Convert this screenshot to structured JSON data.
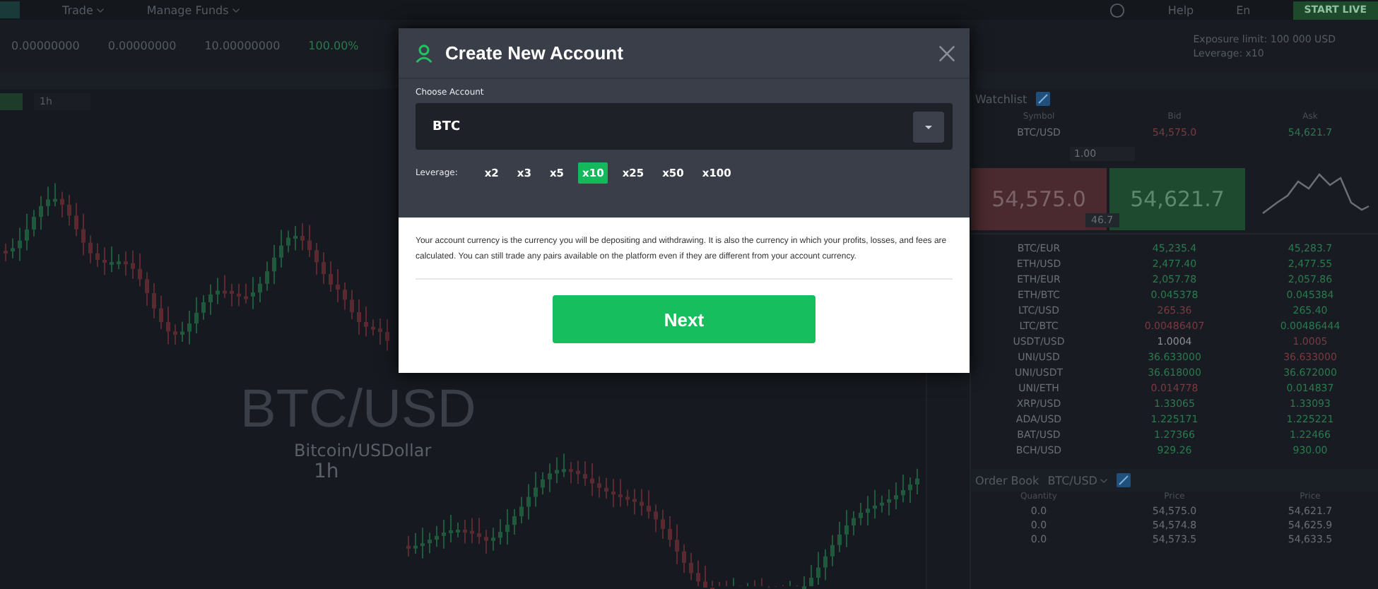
{
  "top_nav": {
    "items": [
      {
        "label": "Trade"
      },
      {
        "label": "Manage Funds"
      }
    ],
    "help": "Help",
    "language": "En",
    "start_button": "START LIVE"
  },
  "stats": {
    "values": [
      {
        "text": "0.00000000",
        "kind": "plain"
      },
      {
        "text": "0.00000000",
        "kind": "plain"
      },
      {
        "text": "10.00000000",
        "kind": "plain"
      },
      {
        "text": "100.00%",
        "kind": "positive"
      }
    ],
    "exposure": "Exposure limit: 100 000 USD",
    "leverage": "Leverage: x10"
  },
  "chart_toolbar": {
    "interval": "1h"
  },
  "chart": {
    "symbol": "BTC/USD",
    "description": "Bitcoin/USDollar",
    "interval": "1h"
  },
  "watchlist": {
    "title": "Watchlist",
    "columns": [
      "Symbol",
      "Bid",
      "Ask"
    ],
    "top_row": {
      "symbol": "BTC/USD",
      "bid": "54,575.0",
      "ask": "54,621.7"
    },
    "trade": {
      "quantity": "1.00",
      "sell_price": "54,575.0",
      "buy_price": "54,621.7",
      "spread": "46.7"
    },
    "rows": [
      {
        "symbol": "BTC/EUR",
        "bid": {
          "text": "45,235.4",
          "color": "#2a7a4e"
        },
        "ask": {
          "text": "45,283.7",
          "color": "#2a7a4e"
        }
      },
      {
        "symbol": "ETH/USD",
        "bid": {
          "text": "2,477.40",
          "color": "#2a7a4e"
        },
        "ask": {
          "text": "2,477.55",
          "color": "#2a7a4e"
        }
      },
      {
        "symbol": "ETH/EUR",
        "bid": {
          "text": "2,057.78",
          "color": "#2a7a4e"
        },
        "ask": {
          "text": "2,057.86",
          "color": "#2a7a4e"
        }
      },
      {
        "symbol": "ETH/BTC",
        "bid": {
          "text": "0.045378",
          "color": "#2a7a4e"
        },
        "ask": {
          "text": "0.045384",
          "color": "#2a7a4e"
        }
      },
      {
        "symbol": "LTC/USD",
        "bid": {
          "text": "265.36",
          "color": "#7a3a40"
        },
        "ask": {
          "text": "265.40",
          "color": "#2a7a4e"
        }
      },
      {
        "symbol": "LTC/BTC",
        "bid": {
          "text": "0.00486407",
          "color": "#7a3a40"
        },
        "ask": {
          "text": "0.00486444",
          "color": "#2a7a4e"
        }
      },
      {
        "symbol": "USDT/USD",
        "bid": {
          "text": "1.0004",
          "color": "#8a8f96"
        },
        "ask": {
          "text": "1.0005",
          "color": "#7a3a40"
        }
      },
      {
        "symbol": "UNI/USD",
        "bid": {
          "text": "36.633000",
          "color": "#2a7a4e"
        },
        "ask": {
          "text": "36.633000",
          "color": "#7a3a40"
        }
      },
      {
        "symbol": "UNI/USDT",
        "bid": {
          "text": "36.618000",
          "color": "#2a7a4e"
        },
        "ask": {
          "text": "36.672000",
          "color": "#2a7a4e"
        }
      },
      {
        "symbol": "UNI/ETH",
        "bid": {
          "text": "0.014778",
          "color": "#7a3a40"
        },
        "ask": {
          "text": "0.014837",
          "color": "#2a7a4e"
        }
      },
      {
        "symbol": "XRP/USD",
        "bid": {
          "text": "1.33065",
          "color": "#2a7a4e"
        },
        "ask": {
          "text": "1.33093",
          "color": "#2a7a4e"
        }
      },
      {
        "symbol": "ADA/USD",
        "bid": {
          "text": "1.225171",
          "color": "#2a7a4e"
        },
        "ask": {
          "text": "1.225221",
          "color": "#2a7a4e"
        }
      },
      {
        "symbol": "BAT/USD",
        "bid": {
          "text": "1.27366",
          "color": "#2a7a4e"
        },
        "ask": {
          "text": "1.22466",
          "color": "#2a7a4e"
        }
      },
      {
        "symbol": "BCH/USD",
        "bid": {
          "text": "929.26",
          "color": "#2a7a4e"
        },
        "ask": {
          "text": "930.00",
          "color": "#2a7a4e"
        }
      }
    ]
  },
  "order_book": {
    "title": "Order Book",
    "symbol": "BTC/USD",
    "columns": [
      "Quantity",
      "Price",
      "Price"
    ],
    "rows": [
      [
        "0.0",
        "54,575.0",
        "54,621.7"
      ],
      [
        "0.0",
        "54,574.8",
        "54,625.9"
      ],
      [
        "0.0",
        "54,573.5",
        "54,633.5"
      ]
    ]
  },
  "modal": {
    "title": "Create New Account",
    "choose_label": "Choose Account",
    "account": "BTC",
    "leverage_label": "Leverage:",
    "leverage_options": [
      {
        "label": "x2",
        "selected": false
      },
      {
        "label": "x3",
        "selected": false
      },
      {
        "label": "x5",
        "selected": false
      },
      {
        "label": "x10",
        "selected": true
      },
      {
        "label": "x25",
        "selected": false
      },
      {
        "label": "x50",
        "selected": false
      },
      {
        "label": "x100",
        "selected": false
      }
    ],
    "description": "Your account currency is the currency you will be depositing and withdrawing. It is also the currency in which your profits, losses, and fees are calculated. You can still trade any pairs available on the platform even if they are different from your account currency.",
    "next_button": "Next"
  }
}
